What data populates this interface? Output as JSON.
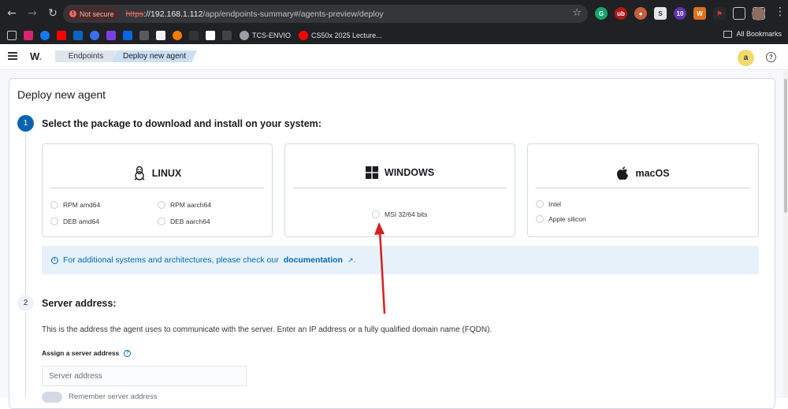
{
  "browser": {
    "not_secure_label": "Not secure",
    "url_scheme": "https",
    "url_host": "://192.168.1.112",
    "url_path": "/app/endpoints-summary#/agents-preview/deploy",
    "bookmarks": [
      {
        "label": "TCS-ENVIO",
        "color": "#9aa0a6"
      },
      {
        "label": "CS50x 2025 Lecture...",
        "color": "#ff0000"
      }
    ],
    "all_bookmarks_label": "All Bookmarks",
    "extension_badge": "10",
    "address_bar_icons": [
      "back-icon",
      "forward-icon",
      "reload-icon",
      "star-icon"
    ]
  },
  "app": {
    "logo": "W",
    "breadcrumbs": [
      "Endpoints",
      "Deploy new agent"
    ],
    "user_initial": "a",
    "help_glyph": "?"
  },
  "page": {
    "title": "Deploy new agent",
    "steps": [
      {
        "number": "1",
        "title": "Select the package to download and install on your system:"
      },
      {
        "number": "2",
        "title": "Server address:"
      }
    ],
    "os_cards": [
      {
        "name": "LINUX",
        "icon": "linux-icon",
        "options": [
          "RPM amd64",
          "RPM aarch64",
          "DEB amd64",
          "DEB aarch64"
        ]
      },
      {
        "name": "WINDOWS",
        "icon": "windows-icon",
        "options": [
          "MSI 32/64 bits"
        ]
      },
      {
        "name": "macOS",
        "icon": "apple-icon",
        "options": [
          "Intel",
          "Apple silicon"
        ]
      }
    ],
    "callout": {
      "text": "For additional systems and architectures, please check our",
      "link": "documentation",
      "suffix": "."
    },
    "server": {
      "description": "This is the address the agent uses to communicate with the server. Enter an IP address or a fully qualified domain name (FQDN).",
      "field_label": "Assign a server address",
      "placeholder": "Server address",
      "remember_label": "Remember server address"
    }
  },
  "colors": {
    "accent": "#0a63b0",
    "callout_bg": "#e6f1fa",
    "annotation_arrow": "#d81f1f"
  }
}
